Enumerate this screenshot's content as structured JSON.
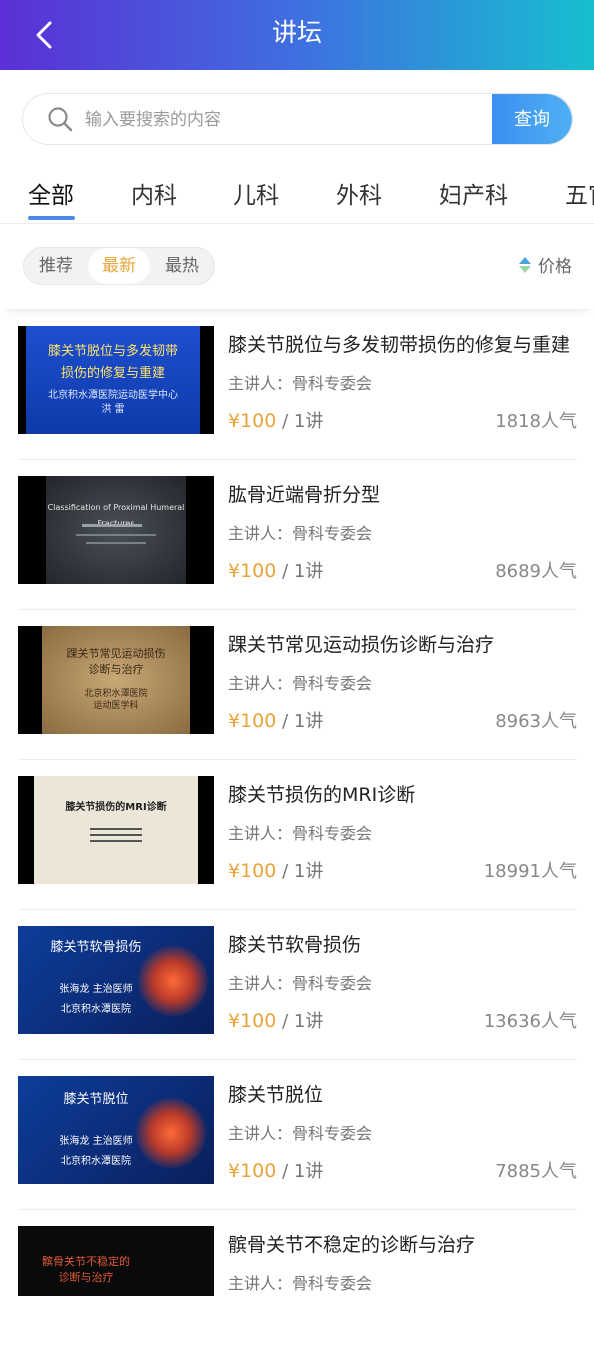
{
  "header": {
    "title": "讲坛",
    "back_icon": "chevron-left-icon"
  },
  "search": {
    "placeholder": "输入要搜索的内容",
    "button_label": "查询",
    "icon": "search-icon"
  },
  "tabs": [
    {
      "label": "全部",
      "active": true
    },
    {
      "label": "内科",
      "active": false
    },
    {
      "label": "儿科",
      "active": false
    },
    {
      "label": "外科",
      "active": false
    },
    {
      "label": "妇产科",
      "active": false
    },
    {
      "label": "五官",
      "active": false
    }
  ],
  "sort": {
    "segments": [
      {
        "label": "推荐",
        "selected": false
      },
      {
        "label": "最新",
        "selected": true
      },
      {
        "label": "最热",
        "selected": false
      }
    ],
    "price_label": "价格",
    "price_icon": "sort-updown-icon"
  },
  "colors": {
    "accent": "#e9a43a",
    "brand_blue": "#4a8ae8",
    "header_start": "#5b2fd6",
    "header_end": "#17bfd0"
  },
  "items": [
    {
      "title": "膝关节脱位与多发韧带损伤的修复与重建",
      "speaker": "主讲人：骨科专委会",
      "price": "¥100",
      "per": " / 1讲",
      "popularity": "1818人气",
      "thumb": {
        "lines": [
          "膝关节脱位与多发韧带",
          "损伤的修复与重建",
          "北京积水潭医院运动医学中心",
          "洪    雷"
        ]
      }
    },
    {
      "title": "肱骨近端骨折分型",
      "speaker": "主讲人：骨科专委会",
      "price": "¥100",
      "per": " / 1讲",
      "popularity": "8689人气",
      "thumb": {
        "lines": [
          "Classification of Proximal Humeral Fractures"
        ]
      }
    },
    {
      "title": "踝关节常见运动损伤诊断与治疗",
      "speaker": "主讲人：骨科专委会",
      "price": "¥100",
      "per": " / 1讲",
      "popularity": "8963人气",
      "thumb": {
        "lines": [
          "踝关节常见运动损伤",
          "诊断与治疗",
          "北京积水潭医院",
          "运动医学科"
        ]
      }
    },
    {
      "title": "膝关节损伤的MRI诊断",
      "speaker": "主讲人：骨科专委会",
      "price": "¥100",
      "per": " / 1讲",
      "popularity": "18991人气",
      "thumb": {
        "lines": [
          "膝关节损伤的MRI诊断"
        ]
      }
    },
    {
      "title": "膝关节软骨损伤",
      "speaker": "主讲人：骨科专委会",
      "price": "¥100",
      "per": " / 1讲",
      "popularity": "13636人气",
      "thumb": {
        "lines": [
          "膝关节软骨损伤",
          "张海龙  主治医师",
          "北京积水潭医院"
        ]
      }
    },
    {
      "title": "膝关节脱位",
      "speaker": "主讲人：骨科专委会",
      "price": "¥100",
      "per": " / 1讲",
      "popularity": "7885人气",
      "thumb": {
        "lines": [
          "膝关节脱位",
          "张海龙  主治医师",
          "北京积水潭医院"
        ]
      }
    },
    {
      "title": "髌骨关节不稳定的诊断与治疗",
      "speaker": "主讲人：骨科专委会",
      "price": "",
      "per": "",
      "popularity": "",
      "thumb": {
        "lines": [
          "髌骨关节不稳定的",
          "诊断与治疗"
        ]
      }
    }
  ]
}
